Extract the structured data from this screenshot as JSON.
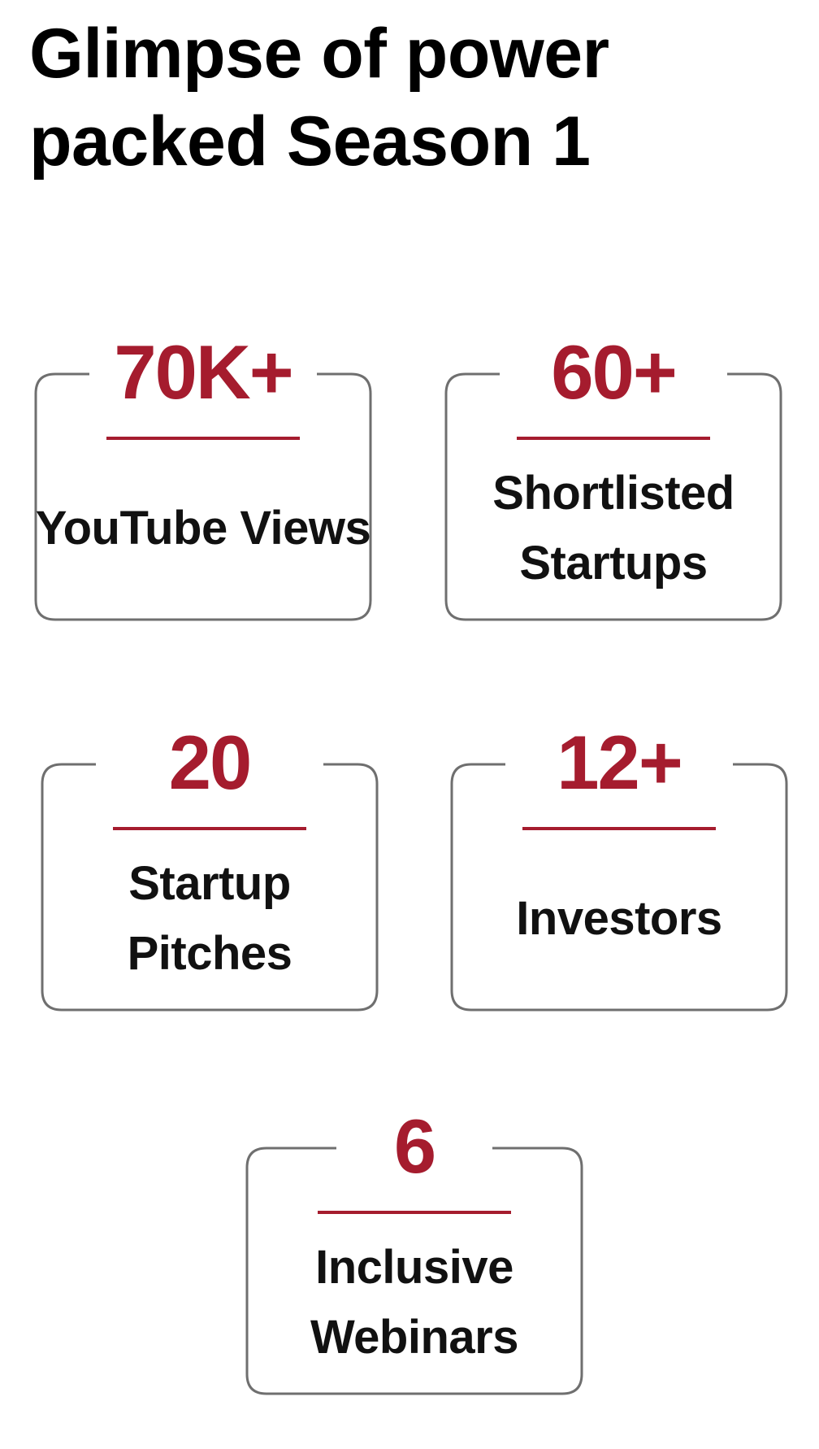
{
  "page": {
    "title": "Glimpse of power packed Season 1"
  },
  "theme": {
    "accent_color": "#a51c2e",
    "border_color": "#6f6f6f",
    "label_color": "#111111",
    "background": "#ffffff"
  },
  "stats": [
    {
      "value": "70K+",
      "label": "YouTube Views"
    },
    {
      "value": "60+",
      "label": "Shortlisted Startups"
    },
    {
      "value": "20",
      "label": "Startup Pitches"
    },
    {
      "value": "12+",
      "label": "Investors"
    },
    {
      "value": "6",
      "label": "Inclusive Webinars"
    }
  ]
}
